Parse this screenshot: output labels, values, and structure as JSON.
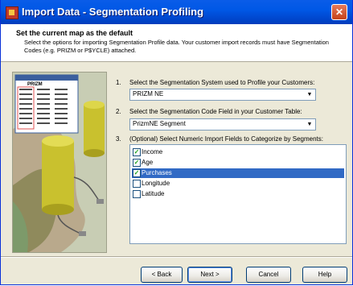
{
  "window": {
    "title": "Import Data - Segmentation Profiling",
    "close_glyph": "✕"
  },
  "header": {
    "title": "Set the current map as the default",
    "description": "Select the options for importing Segmentation Profile data.  Your customer import records must have Segmentation Codes (e.g. PRIZM or P$YCLE) attached."
  },
  "illustration": {
    "label": "PRIZM"
  },
  "steps": [
    {
      "number": "1.",
      "text": "Select the Segmentation System used to Profile your Customers:"
    },
    {
      "number": "2.",
      "text": "Select the Segmentation Code Field in your Customer Table:"
    },
    {
      "number": "3.",
      "text": "(Optional)  Select Numeric Import Fields to Categorize by Segments:"
    }
  ],
  "segmentation_system": {
    "value": "PRIZM NE"
  },
  "code_field": {
    "value": "PrizmNE Segment"
  },
  "fields": [
    {
      "label": "Income",
      "checked": true,
      "selected": false
    },
    {
      "label": "Age",
      "checked": true,
      "selected": false
    },
    {
      "label": "Purchases",
      "checked": true,
      "selected": true
    },
    {
      "label": "Longitude",
      "checked": false,
      "selected": false
    },
    {
      "label": "Latitude",
      "checked": false,
      "selected": false
    }
  ],
  "buttons": {
    "back": "< Back",
    "next": "Next >",
    "cancel": "Cancel",
    "help": "Help"
  }
}
